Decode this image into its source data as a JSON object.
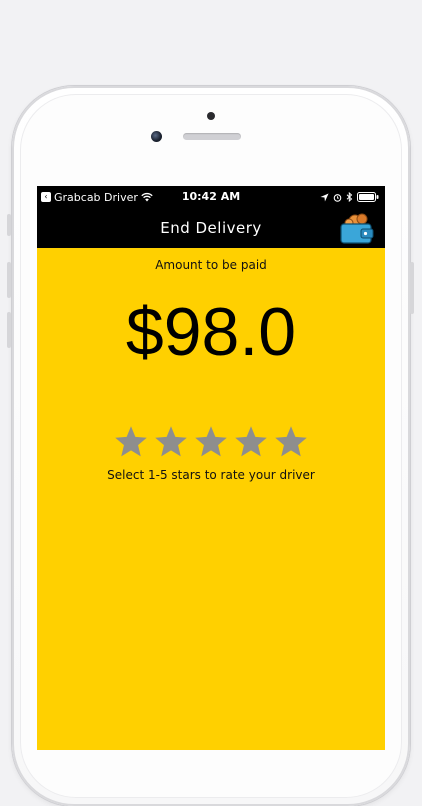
{
  "status_bar": {
    "carrier": "Grabcab Driver",
    "time": "10:42 AM"
  },
  "nav": {
    "title": "End Delivery",
    "wallet_icon": "wallet-icon"
  },
  "payment": {
    "label": "Amount to be paid",
    "amount": "$98.0"
  },
  "rating": {
    "max_stars": 5,
    "selected": 0,
    "hint": "Select 1-5 stars to rate your driver",
    "star_color": "#8e8e8e"
  },
  "colors": {
    "screen_background": "#ffd000",
    "bar_background": "#000000",
    "wallet_body": "#3aa6d9"
  }
}
